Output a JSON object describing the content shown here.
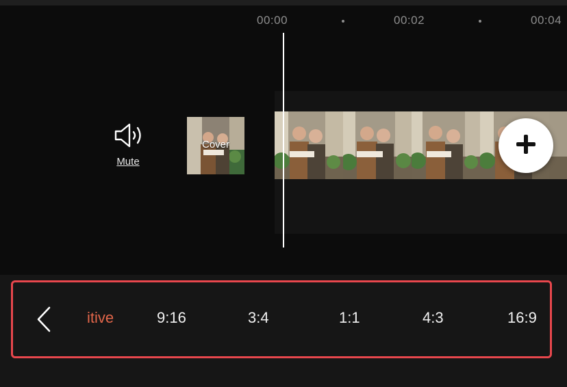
{
  "timeline": {
    "ticks": [
      "00:00",
      "00:02",
      "00:04"
    ]
  },
  "controls": {
    "mute_label": "Mute",
    "cover_label": "Cover",
    "add_icon": "plus-icon",
    "mute_icon": "speaker-icon"
  },
  "ratio_bar": {
    "back_icon": "chevron-left-icon",
    "options": [
      "itive",
      "9:16",
      "3:4",
      "1:1",
      "4:3",
      "16:9"
    ],
    "selected_index": 0
  },
  "colors": {
    "accent": "#e2664a",
    "highlight_border": "#e8474d",
    "background": "#0c0c0c"
  }
}
